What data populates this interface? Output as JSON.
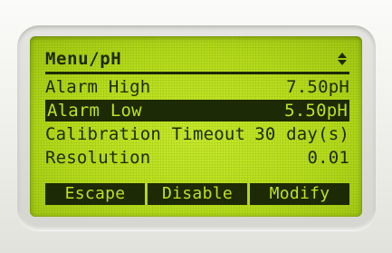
{
  "menu": {
    "title": "Menu/pH"
  },
  "items": [
    {
      "label": "Alarm High",
      "value": "7.50pH"
    },
    {
      "label": "Alarm Low",
      "value": "5.50pH"
    },
    {
      "label": "Calibration Timeout",
      "value": "30 day(s)"
    },
    {
      "label": "Resolution",
      "value": "0.01"
    }
  ],
  "softkeys": {
    "escape": "Escape",
    "disable": "Disable",
    "modify": "Modify"
  },
  "icons": {
    "scroll": "up-down-arrows-icon"
  },
  "colors": {
    "lcd_background": "#bde322",
    "lcd_text": "#1d2a06"
  }
}
